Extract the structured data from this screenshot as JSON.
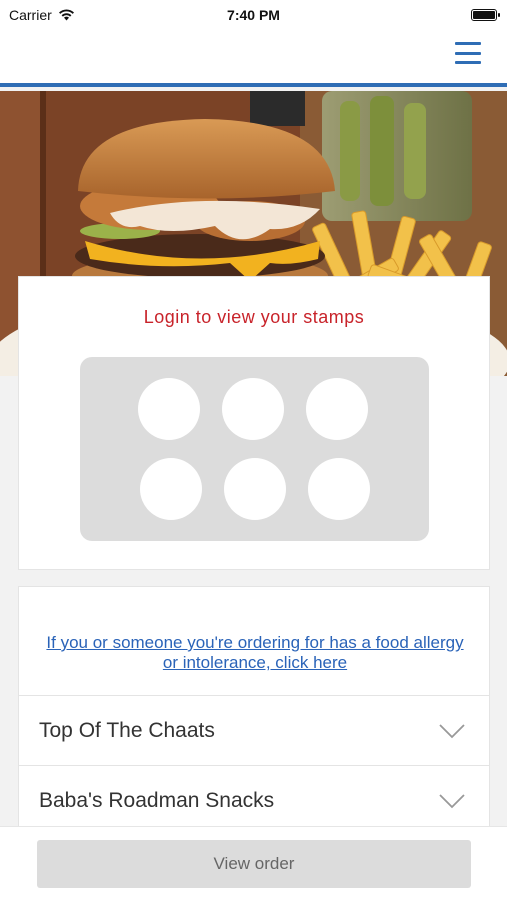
{
  "status_bar": {
    "carrier": "Carrier",
    "time": "7:40 PM"
  },
  "nav": {
    "menu_icon": "hamburger-menu-icon",
    "accent_color": "#2f6db5"
  },
  "hero": {
    "image": "burger-and-fries-photo"
  },
  "stamps": {
    "title": "Login to view your stamps",
    "title_color": "#c8232a",
    "stamp_count": 6,
    "stamps_collected": 0
  },
  "allergy": {
    "link_text": "If you or someone you're ordering for has a food allergy or intolerance, click here",
    "link_color": "#2a63b8"
  },
  "categories": [
    {
      "label": "Top Of The Chaats",
      "icon": "chevron-down-icon"
    },
    {
      "label": "Baba's Roadman Snacks",
      "icon": "chevron-down-icon"
    }
  ],
  "footer": {
    "view_order_label": "View order"
  }
}
